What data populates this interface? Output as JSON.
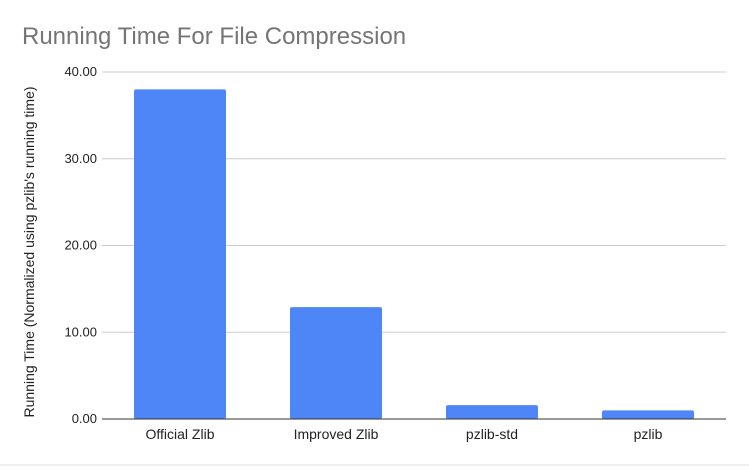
{
  "chart_data": {
    "type": "bar",
    "title": "Running Time For File Compression",
    "xlabel": "",
    "ylabel": "Running Time (Normalized using pzlib's running time)",
    "categories": [
      "Official Zlib",
      "Improved Zlib",
      "pzlib-std",
      "pzlib"
    ],
    "values": [
      38.0,
      12.9,
      1.6,
      1.0
    ],
    "ylim": [
      0,
      40
    ],
    "yticks": [
      "0.00",
      "10.00",
      "20.00",
      "30.00",
      "40.00"
    ],
    "grid": true,
    "legend": "none",
    "bar_color": "#4f86f7"
  }
}
